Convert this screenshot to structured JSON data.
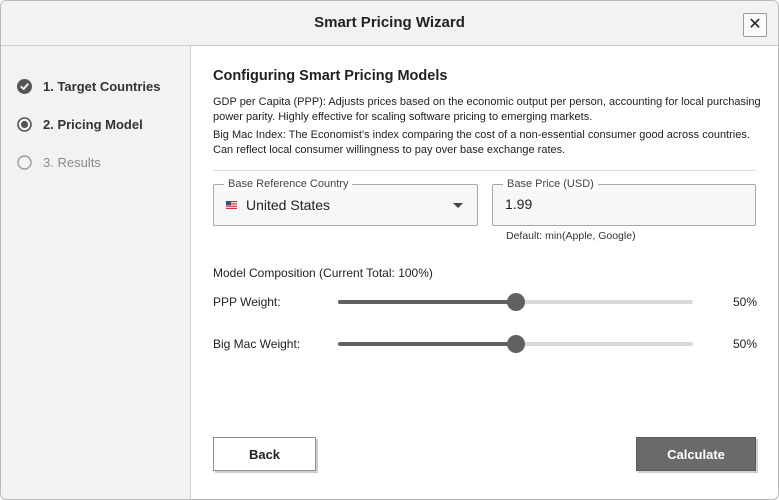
{
  "window": {
    "title": "Smart Pricing Wizard",
    "close_label": "✕"
  },
  "sidebar": {
    "steps": [
      {
        "label": "1. Target Countries",
        "state": "completed"
      },
      {
        "label": "2. Pricing Model",
        "state": "current"
      },
      {
        "label": "3. Results",
        "state": "pending"
      }
    ]
  },
  "main": {
    "heading": "Configuring Smart Pricing Models",
    "ppp_desc": "GDP per Capita (PPP): Adjusts prices based on the economic output per person, accounting for local purchasing power parity. Highly effective for scaling software pricing to emerging markets.",
    "bigmac_desc": "Big Mac Index: The Economist's index comparing the cost of a non-essential consumer good across countries. Can reflect local consumer willingness to pay over base exchange rates.",
    "base_country": {
      "legend": "Base Reference Country",
      "value": "United States",
      "flag": "us-flag-icon"
    },
    "base_price": {
      "legend": "Base Price (USD)",
      "value": "1.99",
      "hint": "Default: min(Apple, Google)"
    },
    "composition_label": "Model Composition (Current Total: 100%)",
    "sliders": [
      {
        "label": "PPP Weight:",
        "value": 50,
        "display": "50%"
      },
      {
        "label": "Big Mac Weight:",
        "value": 50,
        "display": "50%"
      }
    ],
    "back_label": "Back",
    "calculate_label": "Calculate"
  },
  "colors": {
    "accent": "#616161",
    "sidebar_bg": "#f2f2f2",
    "primary_button": "#6a6a6a"
  }
}
